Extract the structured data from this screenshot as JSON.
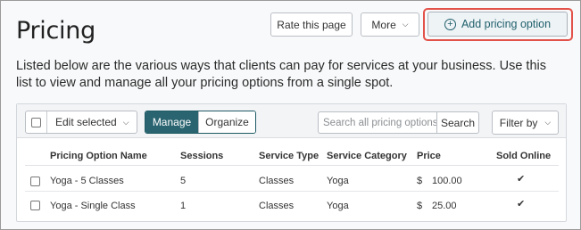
{
  "page": {
    "title": "Pricing",
    "description": "Listed below are the various ways that clients can pay for services at your business. Use this list to view and manage all your pricing options from a single spot."
  },
  "header_buttons": {
    "rate_label": "Rate this page",
    "more_label": "More",
    "add_label": "Add pricing option"
  },
  "toolbar": {
    "edit_selected_label": "Edit selected",
    "manage_label": "Manage",
    "organize_label": "Organize",
    "search_placeholder": "Search all pricing options",
    "search_button_label": "Search",
    "filter_label": "Filter by"
  },
  "table": {
    "columns": [
      "Pricing Option Name",
      "Sessions",
      "Service Type",
      "Service Category",
      "Price",
      "Sold Online"
    ],
    "rows": [
      {
        "name": "Yoga - 5 Classes",
        "sessions": "5",
        "service_type": "Classes",
        "service_category": "Yoga",
        "currency": "$",
        "price": "100.00",
        "sold_online": "✔"
      },
      {
        "name": "Yoga - Single Class",
        "sessions": "1",
        "service_type": "Classes",
        "service_category": "Yoga",
        "currency": "$",
        "price": "25.00",
        "sold_online": "✔"
      }
    ]
  },
  "colors": {
    "accent": "#2a6470",
    "highlight": "#e3524a"
  },
  "icons": {
    "add": "plus-circle-icon",
    "dropdown": "chevron-down-icon",
    "sold_online": "checkmark-icon"
  }
}
